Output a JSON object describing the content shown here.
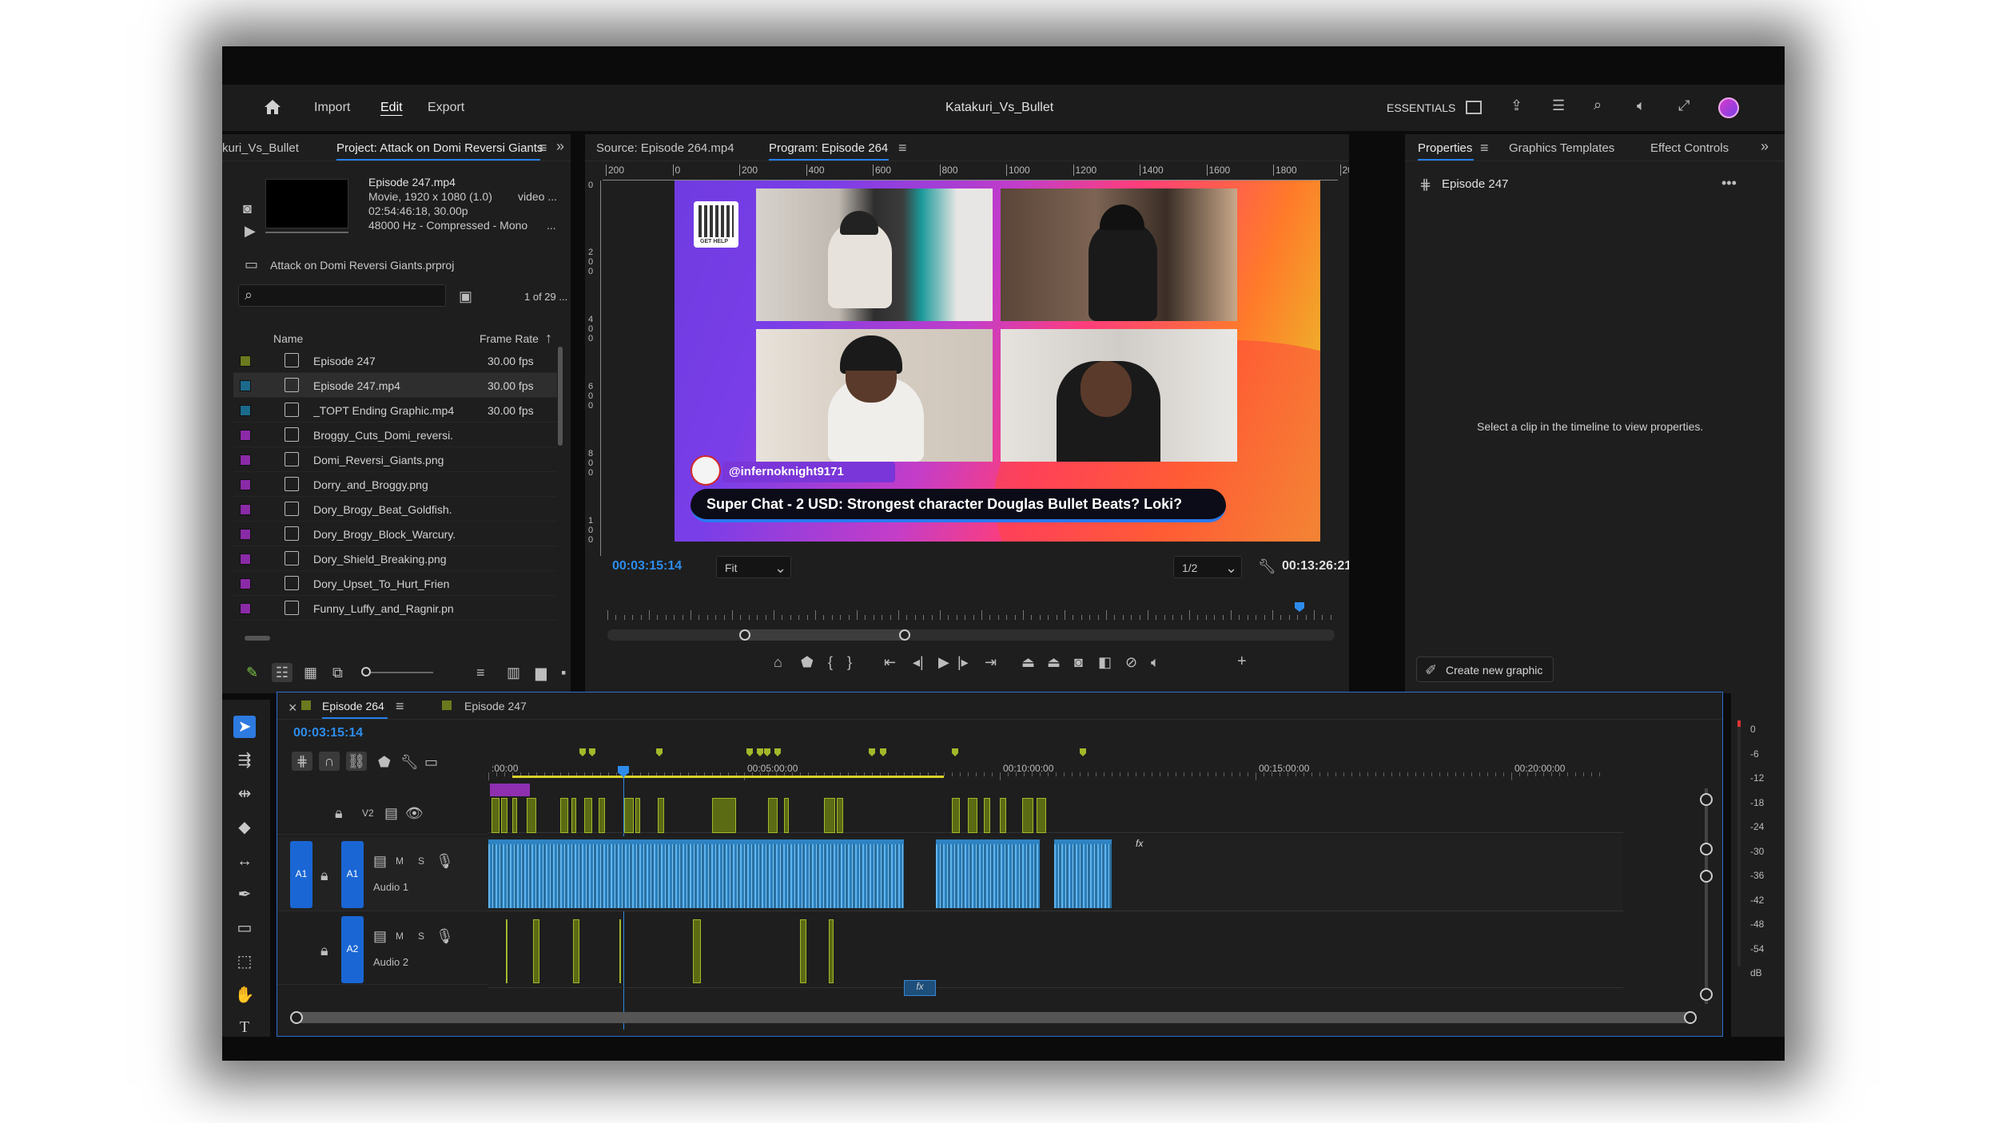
{
  "app": {
    "title": "Katakuri_Vs_Bullet",
    "menu": [
      "Import",
      "Edit",
      "Export"
    ],
    "workspace": "ESSENTIALS"
  },
  "project_panel": {
    "tabs": [
      "kuri_Vs_Bullet",
      "Project: Attack on Domi Reversi Giants"
    ],
    "preview": {
      "name": "Episode 247.mp4",
      "line1": "Movie, 1920 x 1080 (1.0)",
      "line1_suffix": "video ...",
      "line2": "02:54:46:18, 30.00p",
      "line3": "48000 Hz - Compressed - Mono",
      "line3_suffix": "..."
    },
    "project_file": "Attack on Domi Reversi Giants.prproj",
    "search_placeholder": "",
    "count": "1 of 29 ...",
    "columns": [
      "Name",
      "Frame Rate"
    ],
    "items": [
      {
        "name": "Episode 247",
        "rate": "30.00 fps",
        "color": "#6b7a1e",
        "type": "sequence"
      },
      {
        "name": "Episode 247.mp4",
        "rate": "30.00 fps",
        "color": "#1b6a8c",
        "type": "video"
      },
      {
        "name": "_TOPT Ending Graphic.mp4",
        "rate": "30.00 fps",
        "color": "#1b6a8c",
        "type": "video"
      },
      {
        "name": "Broggy_Cuts_Domi_reversi.",
        "rate": "",
        "color": "#8a2aa6",
        "type": "image"
      },
      {
        "name": "Domi_Reversi_Giants.png",
        "rate": "",
        "color": "#8a2aa6",
        "type": "image"
      },
      {
        "name": "Dorry_and_Broggy.png",
        "rate": "",
        "color": "#8a2aa6",
        "type": "image"
      },
      {
        "name": "Dory_Brogy_Beat_Goldfish.",
        "rate": "",
        "color": "#8a2aa6",
        "type": "image"
      },
      {
        "name": "Dory_Brogy_Block_Warcury.",
        "rate": "",
        "color": "#8a2aa6",
        "type": "image"
      },
      {
        "name": "Dory_Shield_Breaking.png",
        "rate": "",
        "color": "#8a2aa6",
        "type": "image"
      },
      {
        "name": "Dory_Upset_To_Hurt_Frien",
        "rate": "",
        "color": "#8a2aa6",
        "type": "image"
      },
      {
        "name": "Funny_Luffy_and_Ragnir.pn",
        "rate": "",
        "color": "#8a2aa6",
        "type": "image"
      }
    ]
  },
  "monitor": {
    "tabs": [
      "Source: Episode 264.mp4",
      "Program: Episode 264"
    ],
    "ruler": [
      "200",
      "0",
      "200",
      "400",
      "600",
      "800",
      "1000",
      "1200",
      "1400",
      "1600",
      "1800",
      "2000"
    ],
    "vruler": [
      "0",
      "2\n0\n0",
      "4\n0\n0",
      "6\n0\n0",
      "8\n0\n0",
      "1\n0\n0"
    ],
    "qr_caption": "GET HELP",
    "username": "@infernoknight9171",
    "superchat": "Super Chat - 2 USD: Strongest character Douglas Bullet Beats? Loki?",
    "timecode": "00:03:15:14",
    "fit": "Fit",
    "resolution": "1/2",
    "duration": "00:13:26:21"
  },
  "properties_panel": {
    "tabs": [
      "Properties",
      "Graphics Templates",
      "Effect Controls"
    ],
    "item": "Episode 247",
    "message": "Select a clip in the timeline to view properties.",
    "create_button": "Create new graphic"
  },
  "timeline": {
    "tabs": [
      "Episode 264",
      "Episode 247"
    ],
    "timecode": "00:03:15:14",
    "ruler": [
      ":00:00",
      "00:05:00:00",
      "00:10:00:00",
      "00:15:00:00",
      "00:20:00:00"
    ],
    "tracks": {
      "v2": {
        "name": "V2"
      },
      "a1": {
        "src": "A1",
        "name": "A1",
        "label": "Audio 1",
        "m": "M",
        "s": "S"
      },
      "a2": {
        "name": "A2",
        "label": "Audio 2",
        "m": "M",
        "s": "S"
      }
    },
    "fx": "fx"
  },
  "meter": {
    "scale": [
      "0",
      "-6",
      "-12",
      "-18",
      "-24",
      "-30",
      "-36",
      "-42",
      "-48",
      "-54",
      "dB"
    ]
  },
  "colors": {
    "accent": "#2680eb",
    "timecode": "#2d8ceb",
    "video_clip": "#5b6b14",
    "audio_clip": "#2c7db8"
  }
}
